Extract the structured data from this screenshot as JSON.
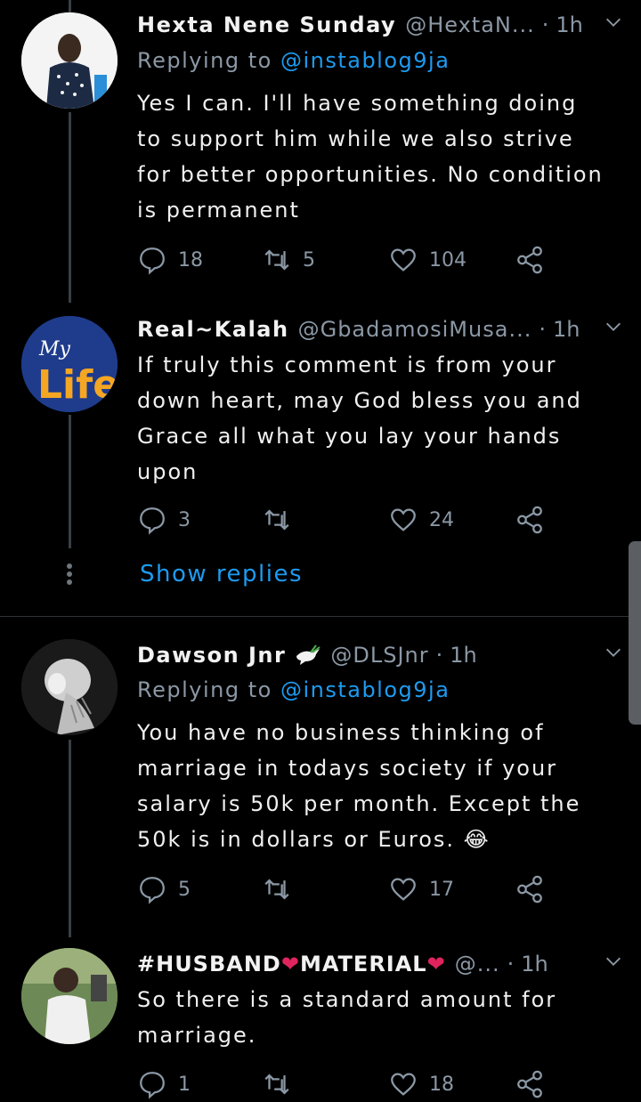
{
  "tweets": [
    {
      "name": "Hexta Nene Sunday",
      "handle": "@HextaN...",
      "time": "1h",
      "replying_prefix": "Replying to ",
      "replying_to": "@instablog9ja",
      "text": "Yes I can. I'll have something doing to support him while we also strive for better opportunities. No condition is permanent",
      "replies": "18",
      "retweets": "5",
      "likes": "104"
    },
    {
      "name": "Real~Kalah",
      "handle": "@GbadamosiMusa...",
      "time": "1h",
      "text": "If truly this comment is from your down heart, may God bless you and Grace all what you lay your hands upon",
      "replies": "3",
      "retweets": "",
      "likes": "24",
      "avatar_text_top": "My",
      "avatar_text_bottom": "Life",
      "show_replies": "Show replies"
    },
    {
      "name": "Dawson Jnr",
      "handle": "@DLSJnr",
      "time": "1h",
      "replying_prefix": "Replying to ",
      "replying_to": "@instablog9ja",
      "text": "You have no business thinking of marriage in todays society if your salary is 50k per month. Except the 50k is in dollars or Euros. 😂",
      "replies": "5",
      "retweets": "",
      "likes": "17"
    },
    {
      "name_part1": "#HUSBAND",
      "name_part2": "MATERIAL",
      "heart": "❤",
      "handle": "@...",
      "time": "1h",
      "text": "So there is a standard amount for marriage.",
      "replies": "1",
      "retweets": "",
      "likes": "18"
    }
  ],
  "separator_dot": "·",
  "colors": {
    "accent": "#1d9bf0",
    "muted": "#8b98a5",
    "background": "#000000"
  }
}
